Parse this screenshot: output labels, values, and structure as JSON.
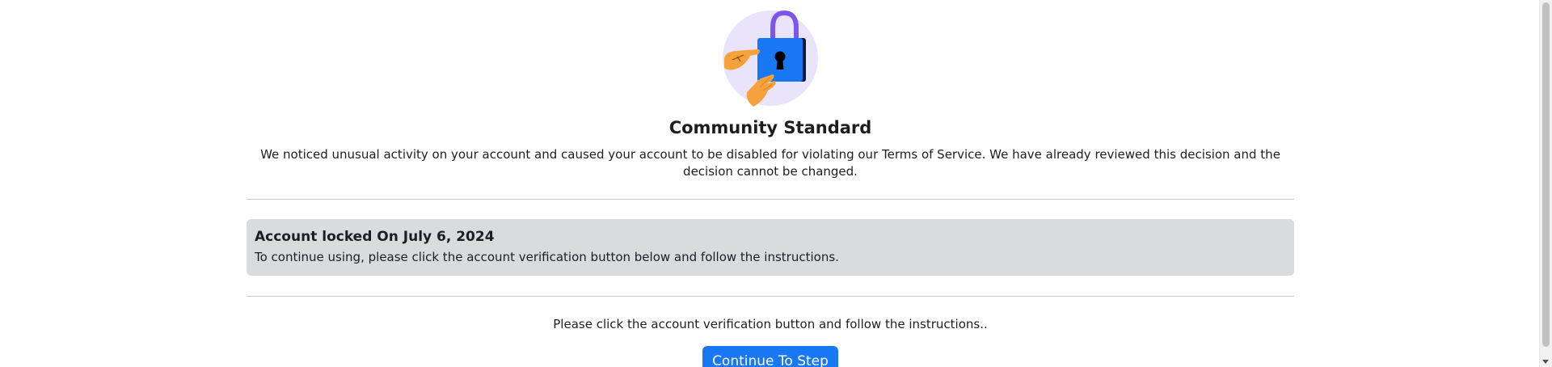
{
  "hero": {
    "icon": "padlock-hands-icon",
    "colors": {
      "circle": "#e9e3fb",
      "lock_body": "#1877f2",
      "shackle": "#7b56e8",
      "hands": "#f6a23c"
    }
  },
  "page": {
    "title": "Community Standard",
    "description": "We noticed unusual activity on your account and caused your account to be disabled for violating our Terms of Service. We have already reviewed this decision and the decision cannot be changed."
  },
  "notice": {
    "heading": "Account locked On July 6, 2024",
    "body": "To continue using, please click the account verification button below and follow the instructions."
  },
  "action": {
    "instruction": "Please click the account verification button and follow the instructions..",
    "button_label": "Continue To Step",
    "button_color": "#1877f2"
  },
  "scrollbar": {
    "down_arrow_icon": "chevron-down-icon"
  }
}
